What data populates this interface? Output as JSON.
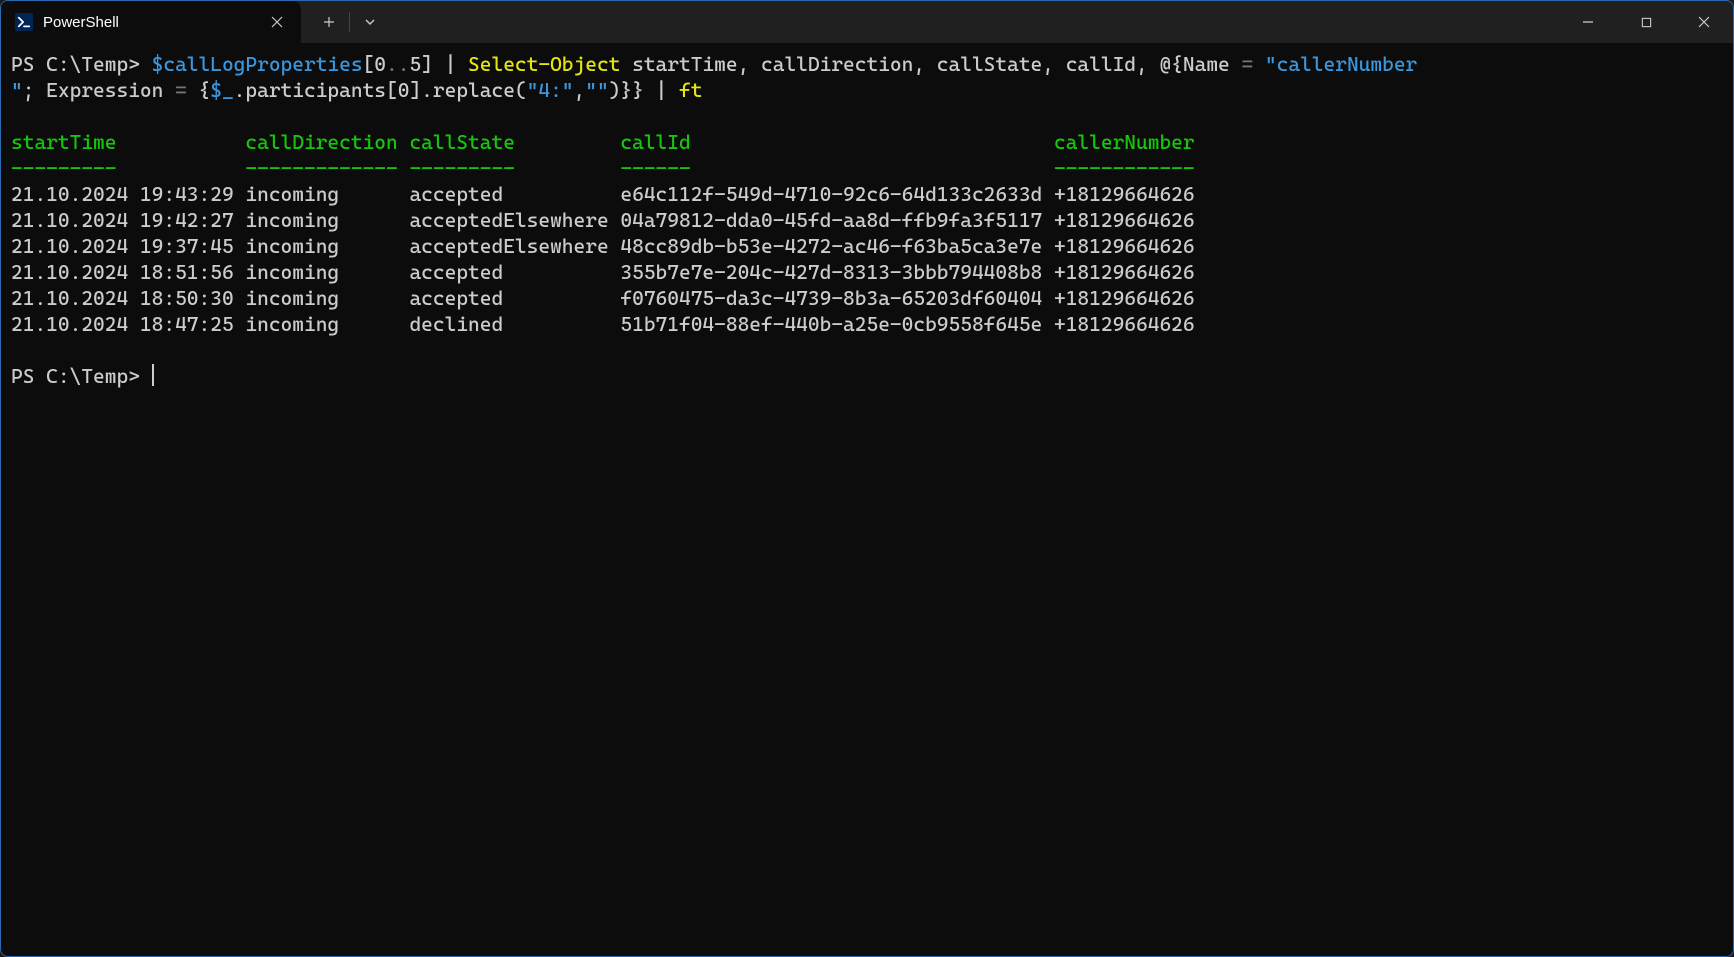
{
  "window": {
    "tab_title": "PowerShell"
  },
  "prompt1": {
    "prefix": "PS C:\\Temp> ",
    "seg_var": "$callLogProperties",
    "seg_bracket_open": "[",
    "seg_idx0": "0",
    "seg_range": "..",
    "seg_idx1": "5",
    "seg_bracket_close": "]",
    "seg_pipe1": " | ",
    "seg_cmd": "Select-Object",
    "seg_props": " startTime, callDirection, callState, callId, ",
    "seg_hash": "@{",
    "seg_name_lbl": "Name ",
    "seg_eq": "= ",
    "seg_name_val": "\"callerNumber",
    "seg_name_val2": "\"",
    "seg_semi": "; ",
    "seg_expr_lbl": "Expression ",
    "seg_eq2": "= ",
    "seg_brace": "{",
    "seg_dollar": "$_",
    "seg_method": ".participants[",
    "seg_idx2": "0",
    "seg_method2": "].replace(",
    "seg_str1": "\"4:\"",
    "seg_comma": ",",
    "seg_str2": "\"\"",
    "seg_close": ")}} ",
    "seg_pipe2": "| ",
    "seg_ft": "ft"
  },
  "table": {
    "headers": {
      "startTime": "startTime",
      "callDirection": "callDirection",
      "callState": "callState",
      "callId": "callId",
      "callerNumber": "callerNumber"
    },
    "dashes": {
      "startTime": "---------",
      "callDirection": "-------------",
      "callState": "---------",
      "callId": "------",
      "callerNumber": "------------"
    },
    "rows": [
      {
        "startTime": "21.10.2024 19:43:29",
        "callDirection": "incoming",
        "callState": "accepted",
        "callId": "e64c112f-549d-4710-92c6-64d133c2633d",
        "callerNumber": "+18129664626"
      },
      {
        "startTime": "21.10.2024 19:42:27",
        "callDirection": "incoming",
        "callState": "acceptedElsewhere",
        "callId": "04a79812-dda0-45fd-aa8d-ffb9fa3f5117",
        "callerNumber": "+18129664626"
      },
      {
        "startTime": "21.10.2024 19:37:45",
        "callDirection": "incoming",
        "callState": "acceptedElsewhere",
        "callId": "48cc89db-b53e-4272-ac46-f63ba5ca3e7e",
        "callerNumber": "+18129664626"
      },
      {
        "startTime": "21.10.2024 18:51:56",
        "callDirection": "incoming",
        "callState": "accepted",
        "callId": "355b7e7e-204c-427d-8313-3bbb794408b8",
        "callerNumber": "+18129664626"
      },
      {
        "startTime": "21.10.2024 18:50:30",
        "callDirection": "incoming",
        "callState": "accepted",
        "callId": "f0760475-da3c-4739-8b3a-65203df60404",
        "callerNumber": "+18129664626"
      },
      {
        "startTime": "21.10.2024 18:47:25",
        "callDirection": "incoming",
        "callState": "declined",
        "callId": "51b71f04-88ef-440b-a25e-0cb9558f645e",
        "callerNumber": "+18129664626"
      }
    ]
  },
  "prompt2": {
    "prefix": "PS C:\\Temp> "
  }
}
